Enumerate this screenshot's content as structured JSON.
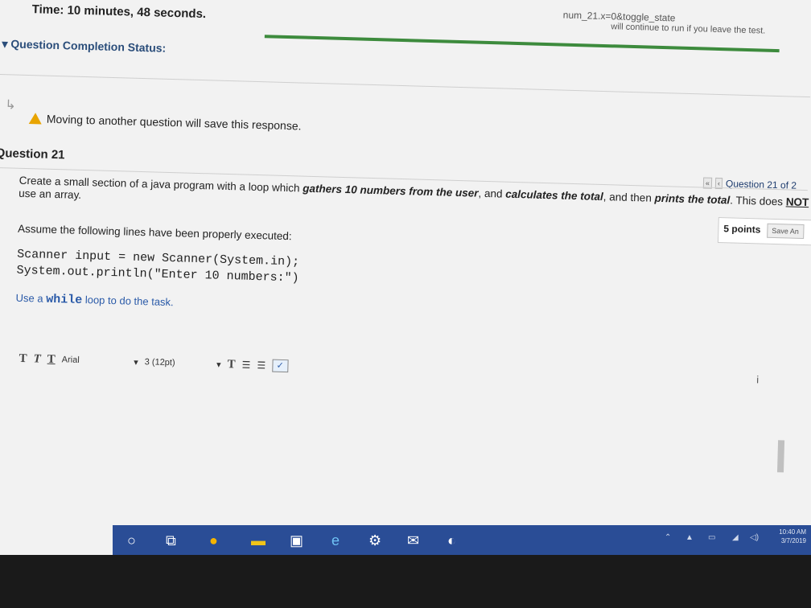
{
  "header": {
    "timer_text": "Time: 10 minutes, 48 seconds.",
    "url_fragment": "num_21.x=0&toggle_state",
    "top_notice": "will continue to run if you leave the test."
  },
  "completion": {
    "label": "Question Completion Status:"
  },
  "warning": {
    "text": "Moving to another question will save this response."
  },
  "question": {
    "title": "Question 21",
    "nav_first": "«",
    "nav_prev": "‹",
    "counter": "Question 21 of 2",
    "points": "5 points",
    "save_label": "Save An",
    "prompt_part1": "Create a small section of a java program with a loop which ",
    "prompt_b1": "gathers 10 numbers from the user",
    "prompt_part2": ", and ",
    "prompt_b2": "calculates the total",
    "prompt_part3": ", and then ",
    "prompt_b3": "prints the total",
    "prompt_part4": ". This does ",
    "prompt_not": "NOT",
    "prompt_line2": "use an array.",
    "assume": "Assume the following lines have been properly executed:",
    "code_line1": "Scanner input = new Scanner(System.in);",
    "code_line2": "System.out.println(\"Enter 10 numbers:\")",
    "use_prefix": "Use a ",
    "use_keyword": "while",
    "use_suffix": " loop to do the task."
  },
  "toolbar": {
    "t1": "T",
    "t2": "T",
    "t3": "T",
    "font": "Arial",
    "size": "3 (12pt)",
    "dropdown": "▾",
    "text_color": "T",
    "list1": "☰",
    "list2": "☰",
    "spell": "✓",
    "right_icons": "i"
  },
  "taskbar": {
    "clock_time": "10:40 AM",
    "clock_date": "3/7/2019"
  },
  "colors": {
    "link": "#2a5aa8",
    "progress": "#3d8b3d",
    "taskbar": "#2a4d96"
  }
}
